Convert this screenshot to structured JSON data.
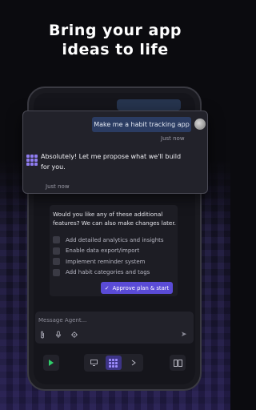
{
  "headline": {
    "line1": "Bring your app",
    "line2": "ideas to life"
  },
  "chat": {
    "user_message": "Make me a habit tracking app",
    "user_time": "Just now",
    "agent_message": "Absolutely! Let me propose what we'll build for you.",
    "agent_time": "Just now"
  },
  "features": {
    "prompt": "Would you like any of these additional features? We can also make changes later.",
    "items": [
      {
        "label": "Add detailed analytics and insights",
        "checked": false
      },
      {
        "label": "Enable data export/import",
        "checked": false
      },
      {
        "label": "Implement reminder system",
        "checked": false
      },
      {
        "label": "Add habit categories and tags",
        "checked": false
      }
    ],
    "approve_label": "Approve plan & start"
  },
  "input": {
    "placeholder": "Message Agent..."
  },
  "icons": {
    "attach": "paperclip-icon",
    "mic": "microphone-icon",
    "settings": "gear-icon",
    "send": "send-icon",
    "run": "play-icon",
    "preview": "monitor-icon",
    "apps": "grid-icon",
    "deploy": "arrow-icon",
    "panels": "panel-icon"
  },
  "colors": {
    "accent": "#5a4bd6",
    "user_bubble": "#2b3c62",
    "run": "#2fce6a",
    "background": "#0b0b0f"
  }
}
